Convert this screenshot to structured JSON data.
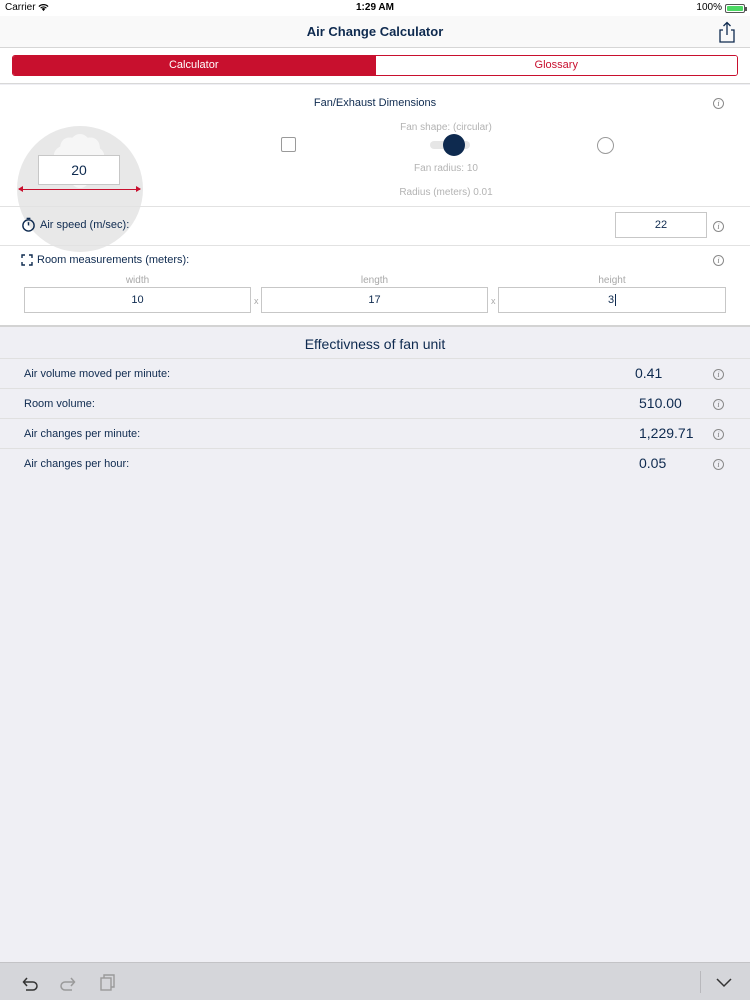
{
  "status_bar": {
    "carrier": "Carrier",
    "time": "1:29 AM",
    "battery": "100%",
    "battery_level": 1.0
  },
  "nav": {
    "title": "Air Change Calculator",
    "share_icon": "share-icon"
  },
  "tabs": [
    {
      "label": "Calculator",
      "active": true
    },
    {
      "label": "Glossary",
      "active": false
    }
  ],
  "fan": {
    "section_title": "Fan/Exhaust Dimensions",
    "dimension_value": "20",
    "shape_label": "Fan shape: (circular)",
    "radius_label": "Fan radius: 10",
    "radius_meters_label": "Radius (meters) 0.01",
    "icons": [
      "square-shape-icon",
      "slider-knob",
      "circle-shape-icon"
    ]
  },
  "air_speed": {
    "label": "Air speed (m/sec):",
    "value": "22"
  },
  "room": {
    "label": "Room measurements (meters):",
    "width_label": "width",
    "width_value": "10",
    "length_label": "length",
    "length_value": "17",
    "height_label": "height",
    "height_value": "3",
    "times": "x"
  },
  "results": {
    "title": "Effectivness of fan unit",
    "rows": [
      {
        "label": "Air volume moved per minute:",
        "value": "0.41"
      },
      {
        "label": "Room volume:",
        "value": "510.00"
      },
      {
        "label": "Air changes per minute:",
        "value": "1,229.71"
      },
      {
        "label": "Air changes per hour:",
        "value": "0.05"
      }
    ]
  },
  "toolbar": {
    "icons": [
      "undo-icon",
      "redo-icon",
      "paste-icon",
      "keyboard-dismiss-icon"
    ]
  },
  "colors": {
    "accent": "#c8102e",
    "text": "#0e2a4f",
    "background": "#efeff4"
  },
  "info_glyph": "i"
}
